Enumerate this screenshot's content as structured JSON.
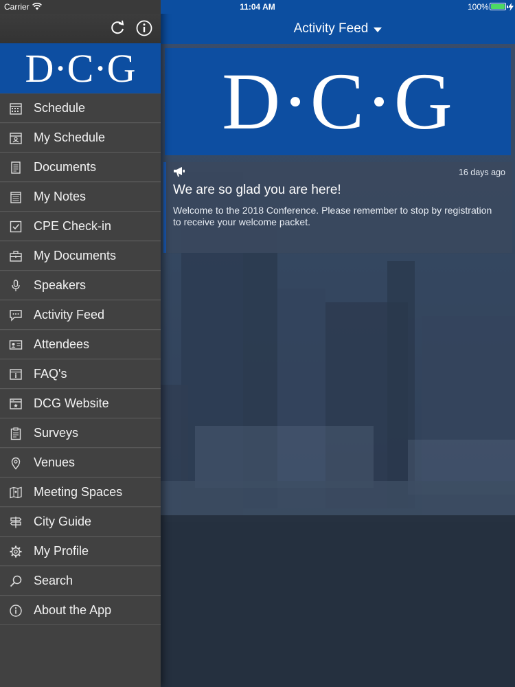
{
  "status_bar": {
    "carrier": "Carrier",
    "time": "11:04 AM",
    "battery": "100%"
  },
  "sidebar": {
    "logo": "D·C·G",
    "items": [
      {
        "label": "Schedule",
        "icon": "calendar-icon"
      },
      {
        "label": "My Schedule",
        "icon": "person-calendar-icon"
      },
      {
        "label": "Documents",
        "icon": "document-icon"
      },
      {
        "label": "My Notes",
        "icon": "notepad-icon"
      },
      {
        "label": "CPE Check-in",
        "icon": "checkbox-icon"
      },
      {
        "label": "My Documents",
        "icon": "briefcase-icon"
      },
      {
        "label": "Speakers",
        "icon": "microphone-icon"
      },
      {
        "label": "Activity Feed",
        "icon": "chat-bubble-icon"
      },
      {
        "label": "Attendees",
        "icon": "id-card-icon"
      },
      {
        "label": "FAQ's",
        "icon": "info-box-icon"
      },
      {
        "label": "DCG Website",
        "icon": "browser-icon"
      },
      {
        "label": "Surveys",
        "icon": "clipboard-icon"
      },
      {
        "label": "Venues",
        "icon": "map-pin-icon"
      },
      {
        "label": "Meeting Spaces",
        "icon": "floor-map-icon"
      },
      {
        "label": "City Guide",
        "icon": "signpost-icon"
      },
      {
        "label": "My Profile",
        "icon": "gear-icon"
      },
      {
        "label": "Search",
        "icon": "search-icon"
      },
      {
        "label": "About the App",
        "icon": "info-circle-icon"
      }
    ]
  },
  "header": {
    "title": "Activity Feed"
  },
  "banner": {
    "logo": "D·C·G"
  },
  "feed": {
    "time": "16 days ago",
    "title": "We are so glad you are here!",
    "body": "Welcome to the 2018 Conference. Please remember to stop by registration to receive your welcome packet."
  },
  "colors": {
    "brand_blue": "#0d4ea1",
    "sidebar_bg": "#414141",
    "battery_green": "#4cd964"
  }
}
